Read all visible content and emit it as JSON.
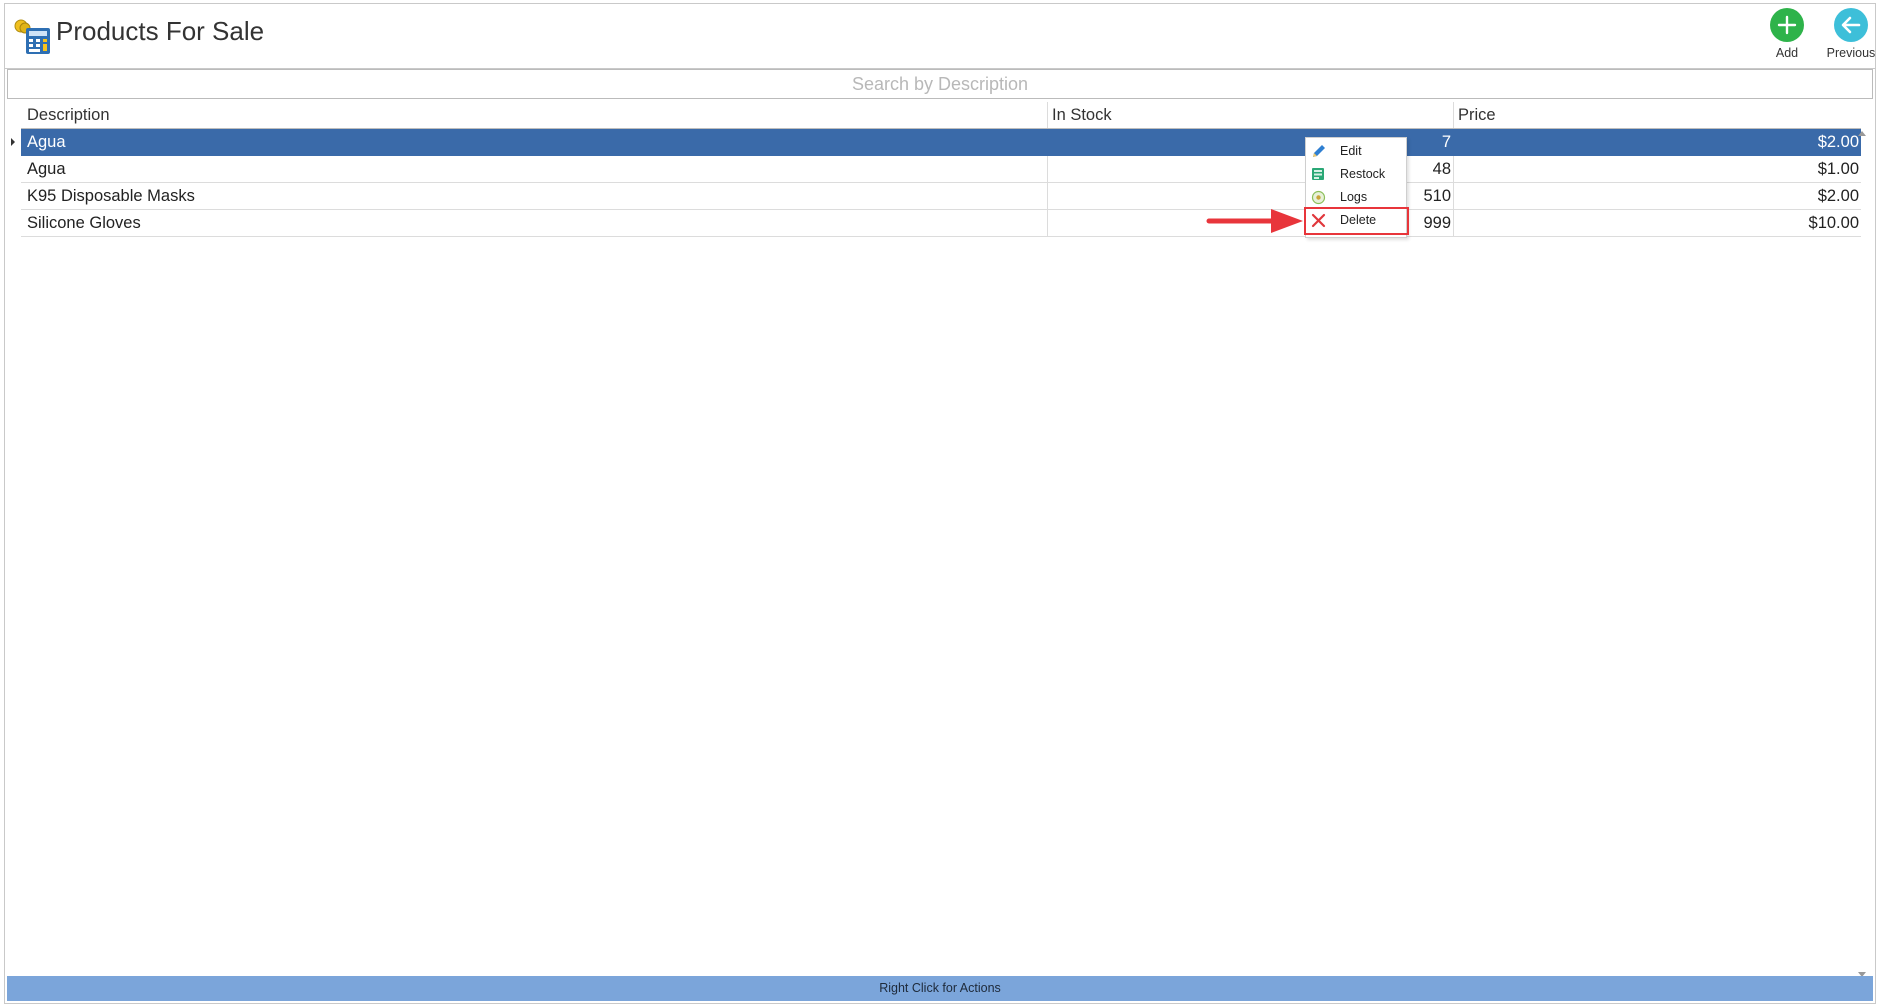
{
  "window": {
    "title": "Products For Sale"
  },
  "header_buttons": {
    "add_label": "Add",
    "previous_label": "Previous"
  },
  "search": {
    "placeholder": "Search by Description"
  },
  "table": {
    "columns": [
      "Description",
      "In Stock",
      "Price"
    ],
    "rows": [
      {
        "description": "Agua",
        "in_stock": "7",
        "price": "$2.00",
        "selected": true
      },
      {
        "description": "Agua",
        "in_stock": "48",
        "price": "$1.00"
      },
      {
        "description": "K95 Disposable Masks",
        "in_stock": "510",
        "price": "$2.00"
      },
      {
        "description": "Silicone Gloves",
        "in_stock": "999",
        "price": "$10.00"
      }
    ]
  },
  "context_menu": {
    "items": [
      {
        "label": "Edit",
        "icon": "pencil-icon"
      },
      {
        "label": "Restock",
        "icon": "restock-icon"
      },
      {
        "label": "Logs",
        "icon": "logs-icon"
      },
      {
        "label": "Delete",
        "icon": "delete-x-icon",
        "highlighted": true
      }
    ]
  },
  "status_bar": {
    "text": "Right Click for Actions"
  },
  "colors": {
    "selected_row": "#3a6aa9",
    "status_bar": "#7ba5da",
    "add": "#2eb34a",
    "previous": "#3dbfd9",
    "highlight": "#e8353b"
  }
}
